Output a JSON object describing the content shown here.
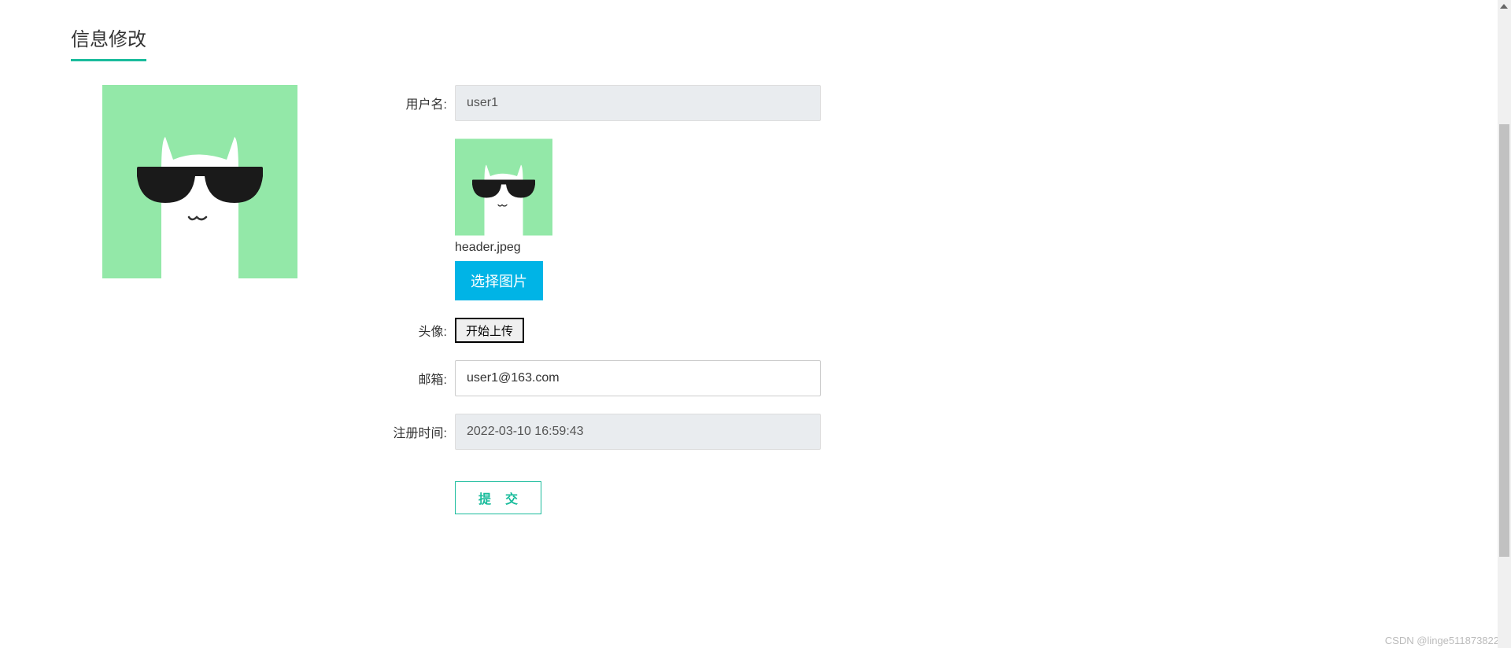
{
  "page_title": "信息修改",
  "form": {
    "username_label": "用户名:",
    "username_value": "user1",
    "avatar_label": "头像:",
    "filename": "header.jpeg",
    "select_image_label": "选择图片",
    "start_upload_label": "开始上传",
    "email_label": "邮箱:",
    "email_value": "user1@163.com",
    "register_time_label": "注册时间:",
    "register_time_value": "2022-03-10 16:59:43",
    "submit_label": "提交"
  },
  "watermark": "CSDN @linge511873822"
}
